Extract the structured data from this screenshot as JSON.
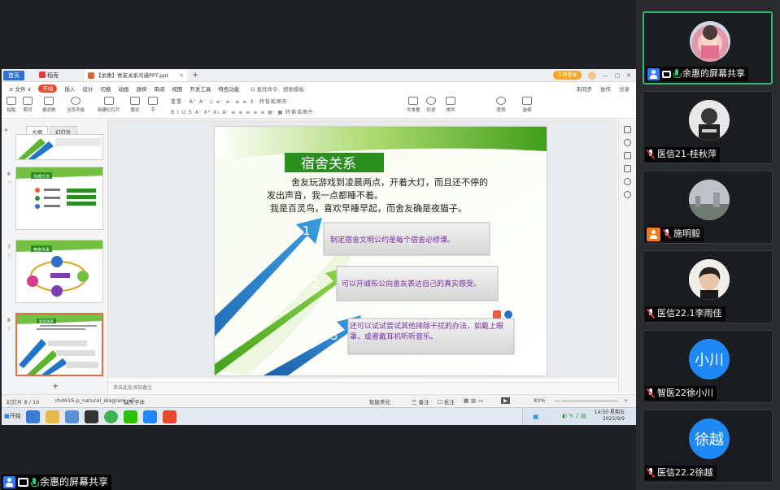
{
  "window": {
    "tab_home": "首页",
    "tab_app": "稻壳",
    "tab_doc": "【余惠】舍友关系沟通PPT.ppt",
    "tab_close": "×",
    "tab_add": "+",
    "login_label": "立即登录",
    "controls": [
      "—",
      "▢",
      "✕"
    ]
  },
  "menubar": {
    "file": "≡ 文件 ∨",
    "items": [
      "开始",
      "插入",
      "设计",
      "切换",
      "动画",
      "放映",
      "审阅",
      "视图",
      "开发工具",
      "特色功能"
    ],
    "active": "开始",
    "search": "Q 查找命令、搜索模板",
    "right_items": [
      "未同步",
      "协作",
      "分享"
    ]
  },
  "ribbon": {
    "groups": [
      {
        "label": "粘贴"
      },
      {
        "label": "剪切"
      },
      {
        "label": "格式刷"
      },
      {
        "label": "当页开始"
      },
      {
        "label": "新建幻灯片"
      },
      {
        "label": "版式"
      },
      {
        "label": "节"
      },
      {
        "label": "文本框"
      },
      {
        "label": "形状"
      },
      {
        "label": "排列"
      },
      {
        "label": "查找"
      },
      {
        "label": "选择"
      }
    ],
    "row1": "重置   ·   A⁺ A⁻ ◇   ≡· ≡·  ≡ ≡  ↕·  转智能图形·",
    "row2": "B  I  U  S  A·  X²  X₂  A·   ≡ ≡ ≡ ≡ ≡  ▤·  ▦ 转换成图片·"
  },
  "left_panel": {
    "tab_outline": "大纲",
    "tab_slides": "幻灯片",
    "slides": [
      {
        "num": "",
        "title": ""
      },
      {
        "num": "6",
        "title": "沟通方法"
      },
      {
        "num": "7",
        "title": "宿舍关系"
      },
      {
        "num": "8",
        "title": "宿舍关系"
      }
    ],
    "add": "+"
  },
  "slide": {
    "title": "宿舍关系",
    "para1_line1": "舍友玩游戏到凌晨两点，开着大灯，而且还不停的",
    "para1_line2": "发出声音，我一点都睡不着。",
    "para2": "我是百灵鸟，喜欢早睡早起，而舍友确是夜猫子。",
    "items": [
      {
        "num": "1",
        "text": "制定宿舍文明公约是每个宿舍必修课。"
      },
      {
        "num": "2",
        "text": "可以开诚布公向舍友表达自己的真实感受。"
      },
      {
        "num": "3",
        "text": "还可以试试尝试其他排除干扰的办法，如戴上眼罩，或者戴耳机听听音乐。"
      }
    ]
  },
  "notes_placeholder": "单击此处添加备注",
  "statusbar": {
    "page": "幻灯片 8 / 10",
    "theme": "rh4615-p_natural_diagram_v7",
    "font": "缺失字体",
    "beautify": "智能美化 ·",
    "notes": "三 备注 ·",
    "comment": "☐ 批注",
    "zoom": "83% ·",
    "minus": "—",
    "plus": "+"
  },
  "taskbar": {
    "start": "开始",
    "time": "14:50 星期五",
    "date": "2022/9/9"
  },
  "share_label": "余惠的屏幕共享",
  "participants": [
    {
      "name": "余惠的屏幕共享",
      "avatar": "photo-pink",
      "active": true,
      "sharing": true
    },
    {
      "name": "医信21-桂秋萍",
      "avatar": "photo-bw",
      "active": false
    },
    {
      "name": "施明毅",
      "avatar": "photo-city",
      "active": false,
      "host_badge": true
    },
    {
      "name": "医信22.1李雨佳",
      "avatar": "photo-person",
      "active": false
    },
    {
      "name": "智医22徐小川",
      "avatar_text": "小川",
      "active": false
    },
    {
      "name": "医信22.2徐越",
      "avatar_text": "徐越",
      "active": false
    }
  ],
  "colors": {
    "accent_green": "#2bbd6b",
    "wps_red": "#e8482c",
    "avatar_blue": "#1e88f5",
    "slide_green": "#4aa81c",
    "arrow_blue": "#1f76c8"
  }
}
